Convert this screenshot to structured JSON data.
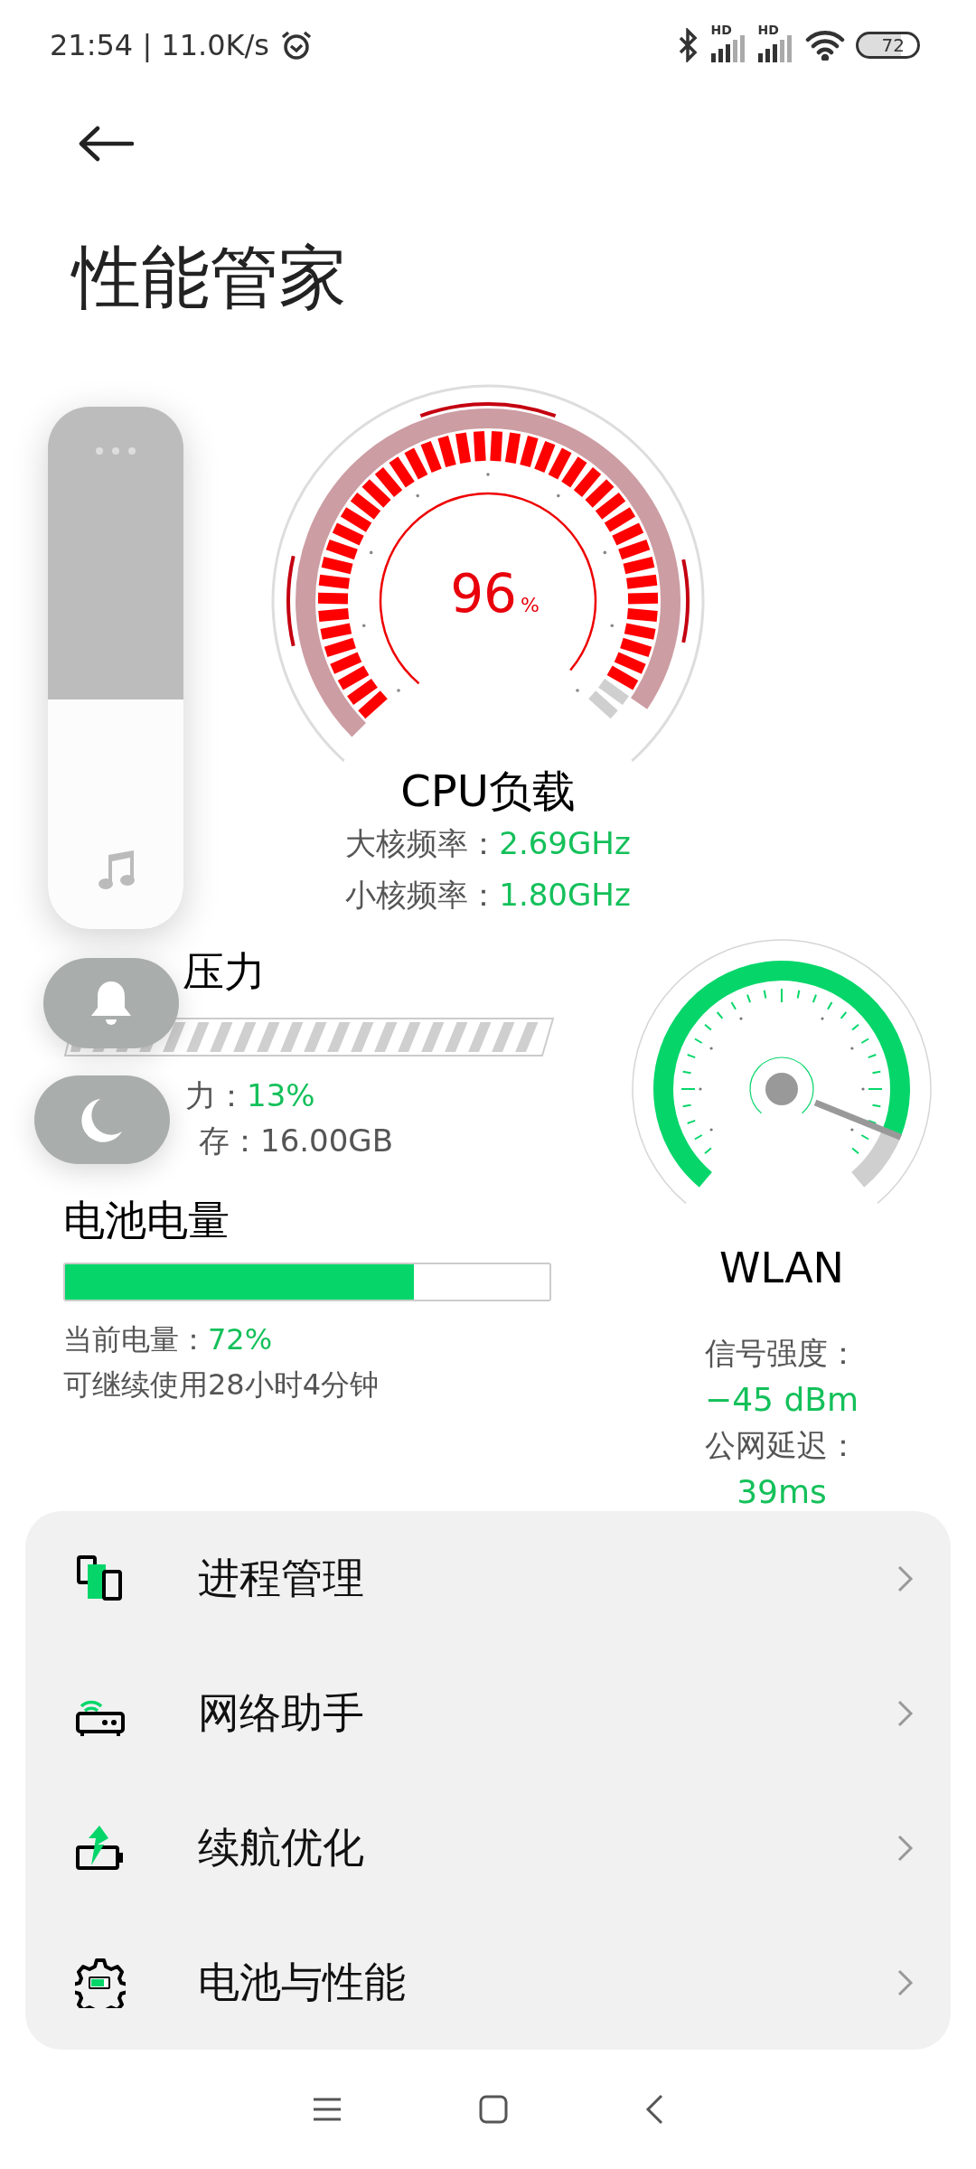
{
  "status_bar": {
    "time": "21:54 | 11.0K/s",
    "signals": [
      {
        "label": "HD"
      },
      {
        "label": "HD"
      }
    ],
    "battery": "72"
  },
  "header": {
    "title": "性能管家"
  },
  "cpu": {
    "value": "96",
    "unit": "%",
    "title": "CPU负载",
    "stats": [
      {
        "label": "大核频率：",
        "value": "2.69GHz"
      },
      {
        "label": "小核频率：",
        "value": "1.80GHz"
      }
    ]
  },
  "memory": {
    "title": "压力",
    "stats": [
      {
        "label": "力：",
        "value": "13%"
      },
      {
        "label": "存：",
        "value": "16.00GB"
      }
    ]
  },
  "battery": {
    "title": "电池电量",
    "level": 0.72,
    "stats": [
      {
        "label": "当前电量：",
        "value": "72%"
      },
      {
        "label": "可继续使用28小时4分钟"
      }
    ]
  },
  "wlan": {
    "title": "WLAN",
    "stats": [
      {
        "label": "信号强度："
      },
      {
        "value": "−45 dBm"
      },
      {
        "label": "公网延迟："
      },
      {
        "value": "39ms"
      }
    ]
  },
  "menu": [
    {
      "kind": "process",
      "label": "进程管理"
    },
    {
      "kind": "network",
      "label": "网络助手"
    },
    {
      "kind": "endurance",
      "label": "续航优化"
    },
    {
      "kind": "settings",
      "label": "电池与性能"
    }
  ],
  "volume_panel": {
    "level": 0.44
  }
}
